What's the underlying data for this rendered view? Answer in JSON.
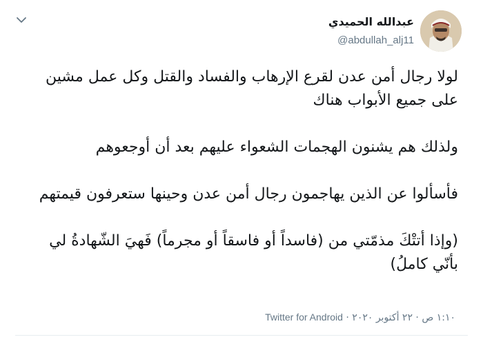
{
  "tweet": {
    "author": {
      "display_name": "عبدالله الحميدي",
      "handle": "@abdullah_alj11",
      "avatar_icon": "user-avatar"
    },
    "menu_icon": "chevron-down-icon",
    "paragraphs": [
      "لولا رجال أمن عدن لقرع الإرهاب والفساد والقتل وكل عمل مشين على جميع الأبواب هناك",
      "ولذلك هم يشنون الهجمات الشعواء عليهم بعد أن أوجعوهم",
      "فأسألوا عن الذين يهاجمون رجال أمن عدن وحينها ستعرفون قيمتهم",
      "(وإذا أتتْكَ مذمّتي من (فاسداً أو فاسقاً أو مجرماً) فَهيَ الشّهادةُ لي بأنّي كاملُ)"
    ],
    "time": "١:١٠ ص",
    "date": "٢٢ أكتوبر ٢٠٢٠",
    "separator": "·",
    "source": "Twitter for Android"
  },
  "colors": {
    "text": "#14171a",
    "secondary": "#657786",
    "divider": "#e6ecf0"
  }
}
